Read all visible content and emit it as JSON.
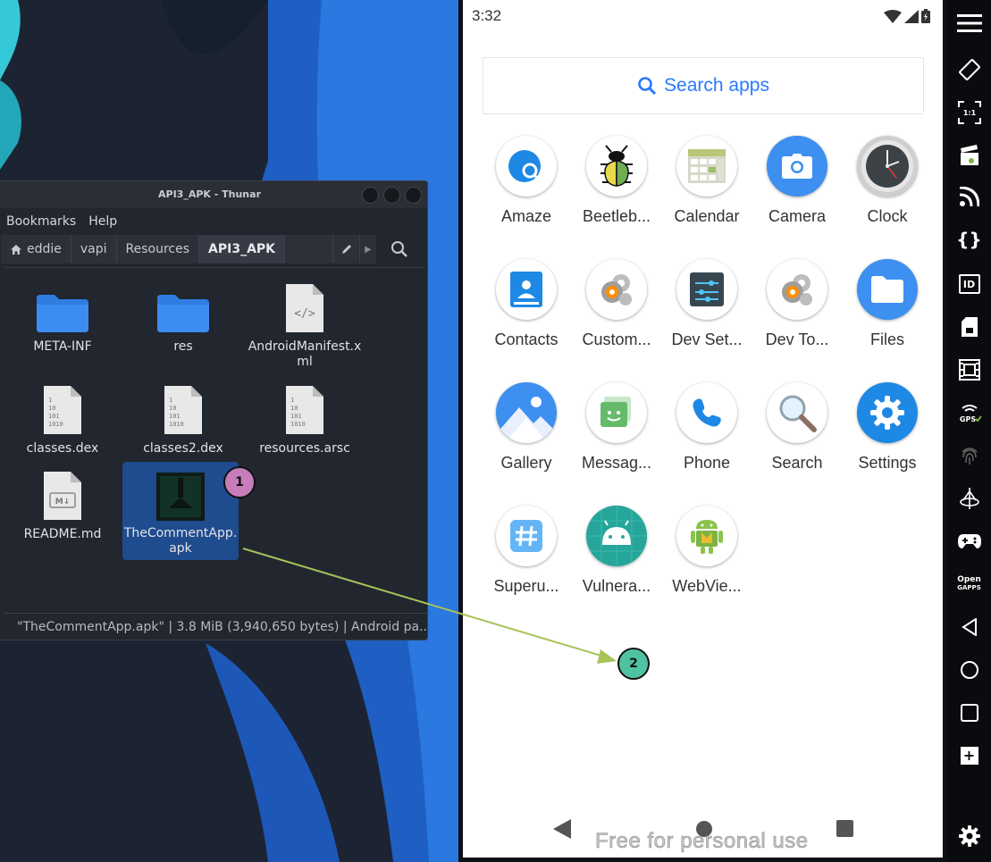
{
  "thunar": {
    "title": "API3_APK - Thunar",
    "menu": [
      "Bookmarks",
      "Help"
    ],
    "path": [
      "eddie",
      "vapi",
      "Resources",
      "API3_APK"
    ],
    "files": [
      {
        "name": "META-INF",
        "icon": "folder-icon"
      },
      {
        "name": "res",
        "icon": "folder-icon"
      },
      {
        "name": "AndroidManifest.xml",
        "icon": "xml-file-icon"
      },
      {
        "name": "classes.dex",
        "icon": "binary-file-icon"
      },
      {
        "name": "classes2.dex",
        "icon": "binary-file-icon"
      },
      {
        "name": "resources.arsc",
        "icon": "binary-file-icon"
      },
      {
        "name": "README.md",
        "icon": "markdown-file-icon"
      },
      {
        "name": "TheCommentApp.apk",
        "icon": "apk-file-icon",
        "selected": true
      }
    ],
    "status": "\"TheCommentApp.apk\" | 3.8 MiB (3,940,650 bytes) | Android pa..."
  },
  "android": {
    "time": "3:32",
    "search_placeholder": "Search apps",
    "apps": [
      {
        "label": "Amaze",
        "icon": "amaze-icon"
      },
      {
        "label": "Beetleb...",
        "icon": "beetle-icon"
      },
      {
        "label": "Calendar",
        "icon": "calendar-icon"
      },
      {
        "label": "Camera",
        "icon": "camera-icon"
      },
      {
        "label": "Clock",
        "icon": "clock-icon"
      },
      {
        "label": "Contacts",
        "icon": "contacts-icon"
      },
      {
        "label": "Custom...",
        "icon": "settings-gears-icon"
      },
      {
        "label": "Dev Set...",
        "icon": "dev-settings-icon"
      },
      {
        "label": "Dev To...",
        "icon": "settings-gears-icon"
      },
      {
        "label": "Files",
        "icon": "files-icon"
      },
      {
        "label": "Gallery",
        "icon": "gallery-icon"
      },
      {
        "label": "Messag...",
        "icon": "messaging-icon"
      },
      {
        "label": "Phone",
        "icon": "phone-icon"
      },
      {
        "label": "Search",
        "icon": "magnifier-icon"
      },
      {
        "label": "Settings",
        "icon": "settings-icon"
      },
      {
        "label": "Superu...",
        "icon": "superuser-icon"
      },
      {
        "label": "Vulnera...",
        "icon": "android-icon"
      },
      {
        "label": "WebVie...",
        "icon": "android-webview-icon"
      }
    ],
    "watermark": "Free for personal use"
  },
  "toolbar": {
    "ratio_label": "1:1",
    "id_label": "ID",
    "gps_label": "GPS",
    "opengapps_label_1": "Open",
    "opengapps_label_2": "GAPPS",
    "plus_label": "+"
  },
  "annotations": {
    "marker1": "1",
    "marker2": "2",
    "marker1_color": "#c77dba",
    "marker2_color": "#4fc3a1",
    "arrow_color": "#a8c35a"
  }
}
